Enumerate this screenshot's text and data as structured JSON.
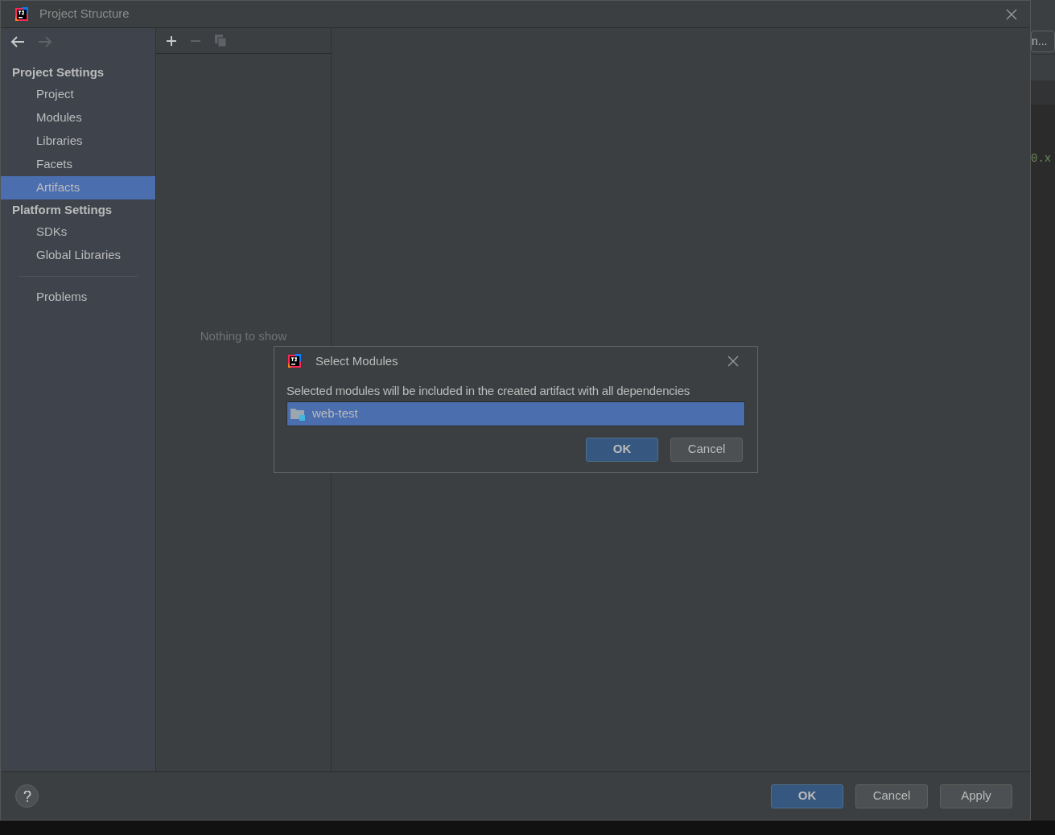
{
  "window": {
    "title": "Project Structure"
  },
  "sidebar": {
    "groups": [
      {
        "header": "Project Settings",
        "items": [
          {
            "label": "Project",
            "selected": false
          },
          {
            "label": "Modules",
            "selected": false
          },
          {
            "label": "Libraries",
            "selected": false
          },
          {
            "label": "Facets",
            "selected": false
          },
          {
            "label": "Artifacts",
            "selected": true
          }
        ]
      },
      {
        "header": "Platform Settings",
        "items": [
          {
            "label": "SDKs",
            "selected": false
          },
          {
            "label": "Global Libraries",
            "selected": false
          }
        ]
      }
    ],
    "footer_items": [
      {
        "label": "Problems",
        "selected": false
      }
    ]
  },
  "list_panel": {
    "empty_text": "Nothing to show"
  },
  "background_ide": {
    "button": "n...",
    "code_fragment": "0.x"
  },
  "dialog": {
    "title": "Select Modules",
    "message": "Selected modules will be included in the created artifact with all dependencies",
    "modules": [
      {
        "label": "web-test",
        "selected": true
      }
    ],
    "buttons": [
      {
        "label": "OK",
        "kind": "primary"
      },
      {
        "label": "Cancel",
        "kind": "secondary"
      }
    ]
  },
  "footer": {
    "buttons": [
      {
        "label": "OK",
        "kind": "primary"
      },
      {
        "label": "Cancel",
        "kind": "secondary"
      },
      {
        "label": "Apply",
        "kind": "secondary"
      }
    ]
  }
}
